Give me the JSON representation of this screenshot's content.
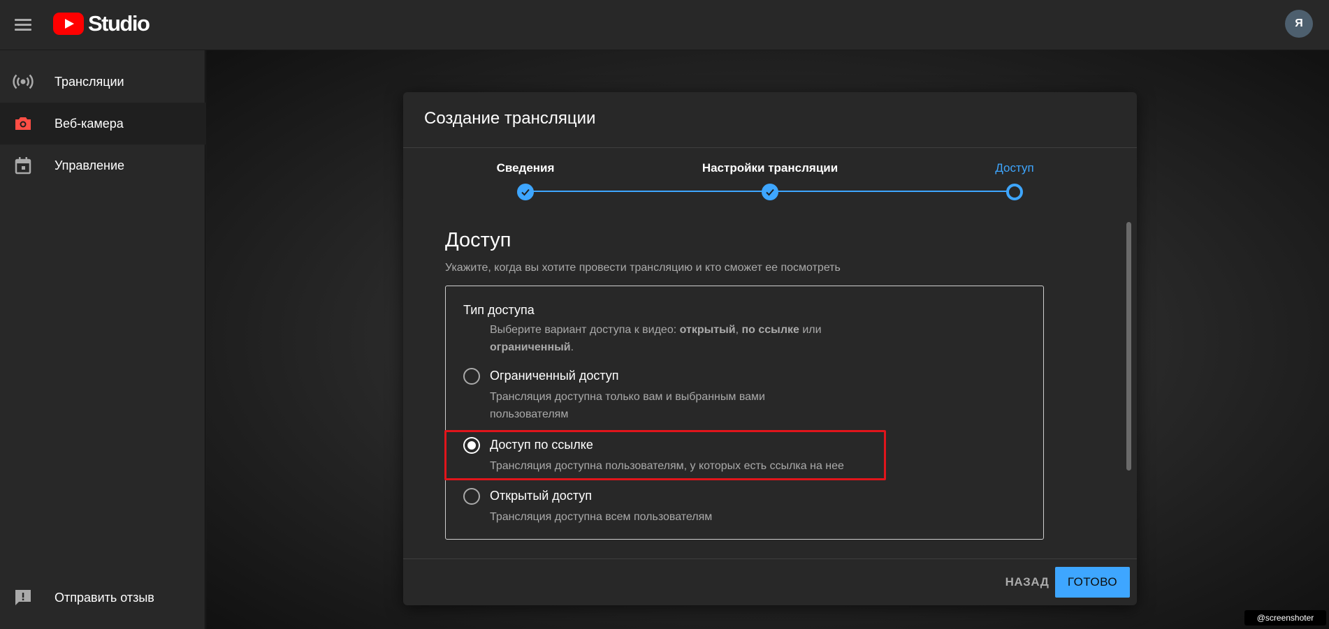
{
  "app": {
    "brand": "Studio",
    "avatar_letter": "Я"
  },
  "sidebar": {
    "items": [
      {
        "label": "Трансляции",
        "icon": "broadcast-icon"
      },
      {
        "label": "Веб-камера",
        "icon": "camera-icon"
      },
      {
        "label": "Управление",
        "icon": "calendar-icon"
      }
    ],
    "feedback_label": "Отправить отзыв"
  },
  "dialog": {
    "title": "Создание трансляции",
    "steps": [
      {
        "label": "Сведения",
        "state": "done"
      },
      {
        "label": "Настройки трансляции",
        "state": "done"
      },
      {
        "label": "Доступ",
        "state": "current"
      }
    ],
    "section_title": "Доступ",
    "section_subtitle": "Укажите, когда вы хотите провести трансляцию и кто сможет ее посмотреть",
    "access": {
      "title": "Тип доступа",
      "desc_prefix": "Выберите вариант доступа к видео: ",
      "desc_public": "открытый",
      "desc_sep": ", ",
      "desc_unlisted": "по ссылке",
      "desc_or": " или ",
      "desc_private": "ограниченный",
      "desc_end": ".",
      "options": [
        {
          "label": "Ограниченный доступ",
          "desc": "Трансляция доступна только вам и выбранным вами пользователям",
          "checked": false
        },
        {
          "label": "Доступ по ссылке",
          "desc": "Трансляция доступна пользователям, у которых есть ссылка на нее",
          "checked": true
        },
        {
          "label": "Открытый доступ",
          "desc": "Трансляция доступна всем пользователям",
          "checked": false
        }
      ]
    },
    "back_label": "НАЗАД",
    "done_label": "ГОТОВО"
  },
  "watermark": "@screenshoter",
  "colors": {
    "accent": "#3ea6ff",
    "highlight": "#e0151b",
    "brand_red": "#ff0000"
  }
}
